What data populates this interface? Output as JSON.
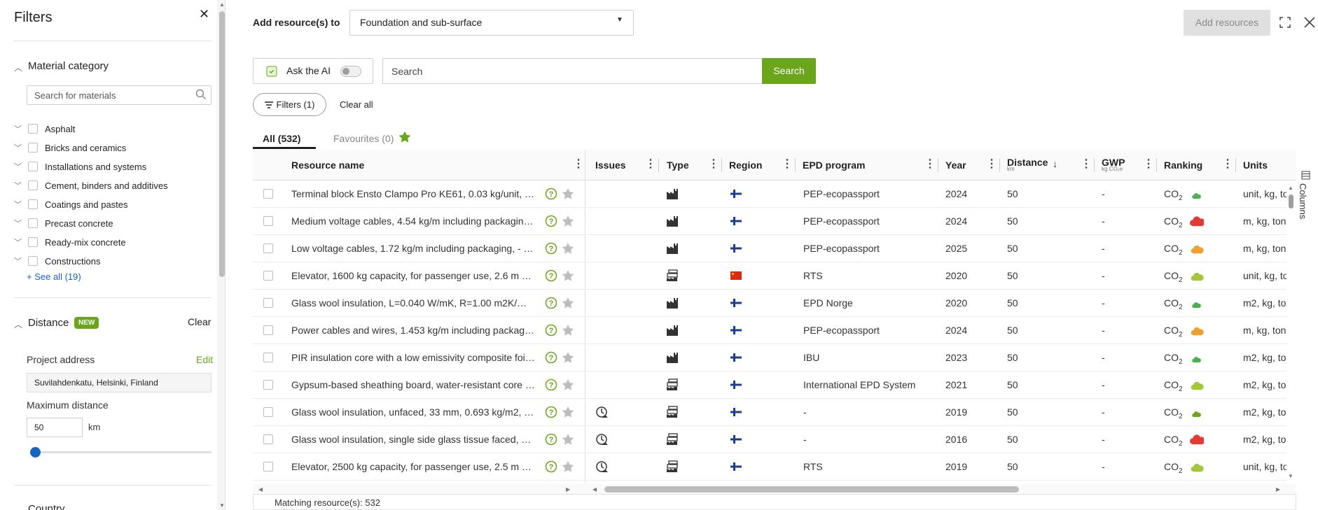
{
  "filters_panel": {
    "title": "Filters",
    "material_category": {
      "title": "Material category",
      "search_placeholder": "Search for materials",
      "items": [
        "Asphalt",
        "Bricks and ceramics",
        "Installations and systems",
        "Cement, binders and additives",
        "Coatings and pastes",
        "Precast concrete",
        "Ready-mix concrete",
        "Constructions"
      ],
      "see_all": "+ See all (19)"
    },
    "distance": {
      "title": "Distance",
      "badge": "NEW",
      "clear": "Clear",
      "project_address_label": "Project address",
      "edit": "Edit",
      "project_address": "Suvilahdenkatu, Helsinki, Finland",
      "max_distance_label": "Maximum distance",
      "max_distance": "50",
      "unit": "km",
      "slider_fraction": 0.0
    },
    "country_title": "Country"
  },
  "top": {
    "add_to_label": "Add resource(s) to",
    "project_selected": "Foundation and sub-surface",
    "add_resources": "Add resources"
  },
  "search": {
    "ai_label": "Ask the AI",
    "placeholder": "Search",
    "button": "Search",
    "filters_button": "Filters (1)",
    "clear_all": "Clear all"
  },
  "tabs": {
    "all": "All (532)",
    "favourites": "Favourites (0)"
  },
  "table": {
    "headers": {
      "resource_name": "Resource name",
      "issues": "Issues",
      "type": "Type",
      "region": "Region",
      "epd_program": "EPD program",
      "year": "Year",
      "distance": "Distance",
      "distance_unit": "km",
      "gwp": "GWP",
      "gwp_unit": "kg CO₂e",
      "ranking": "Ranking",
      "units": "Units"
    },
    "co2_label": "CO",
    "co2_sub": "2",
    "rows": [
      {
        "name": "Terminal block Ensto Clampo Pro KE61, 0.03 kg/unit, …",
        "issue": false,
        "type": "factory",
        "flag": "fi",
        "epd": "PEP-ecopassport",
        "year": "2024",
        "distance": "50",
        "gwp": "-",
        "cloud": "#4caf50",
        "cloud_size": "small",
        "units": "unit, kg, to"
      },
      {
        "name": "Medium voltage cables, 4.54 kg/m including packagin…",
        "issue": false,
        "type": "factory",
        "flag": "fi",
        "epd": "PEP-ecopassport",
        "year": "2024",
        "distance": "50",
        "gwp": "-",
        "cloud": "#e53935",
        "cloud_size": "large",
        "units": "m, kg, ton"
      },
      {
        "name": "Low voltage cables, 1.72 kg/m including packaging, - …",
        "issue": false,
        "type": "factory",
        "flag": "fi",
        "epd": "PEP-ecopassport",
        "year": "2025",
        "distance": "50",
        "gwp": "-",
        "cloud": "#f0a030",
        "cloud_size": "medium",
        "units": "m, kg, ton"
      },
      {
        "name": "Elevator, 1600 kg capacity, for passenger use, 2.6 m …",
        "issue": false,
        "type": "generic",
        "flag": "cn",
        "epd": "RTS",
        "year": "2020",
        "distance": "50",
        "gwp": "-",
        "cloud": "#a4c639",
        "cloud_size": "medium",
        "units": "unit, kg, to"
      },
      {
        "name": "Glass wool insulation, L=0.040 W/mK, R=1.00 m2K/…",
        "issue": false,
        "type": "factory",
        "flag": "fi",
        "epd": "EPD Norge",
        "year": "2020",
        "distance": "50",
        "gwp": "-",
        "cloud": "#4caf50",
        "cloud_size": "small",
        "units": "m2, kg, to"
      },
      {
        "name": "Power cables and wires, 1.453 kg/m including packag…",
        "issue": false,
        "type": "factory",
        "flag": "fi",
        "epd": "PEP-ecopassport",
        "year": "2024",
        "distance": "50",
        "gwp": "-",
        "cloud": "#f0a030",
        "cloud_size": "medium",
        "units": "m, kg, ton"
      },
      {
        "name": "PIR insulation core with a low emissivity composite foi…",
        "issue": false,
        "type": "factory",
        "flag": "fi",
        "epd": "IBU",
        "year": "2023",
        "distance": "50",
        "gwp": "-",
        "cloud": "#4caf50",
        "cloud_size": "small",
        "units": "m2, kg, to"
      },
      {
        "name": "Gypsum-based sheathing board, water-resistant core …",
        "issue": false,
        "type": "generic",
        "flag": "fi",
        "epd": "International EPD System",
        "year": "2021",
        "distance": "50",
        "gwp": "-",
        "cloud": "#a4c639",
        "cloud_size": "medium",
        "units": "m2, kg, to"
      },
      {
        "name": "Glass wool insulation, unfaced, 33 mm, 0.693 kg/m2, …",
        "issue": true,
        "type": "generic",
        "flag": "fi",
        "epd": "-",
        "year": "2019",
        "distance": "50",
        "gwp": "-",
        "cloud": "#6aa51b",
        "cloud_size": "small",
        "units": "m2, kg, to"
      },
      {
        "name": "Glass wool insulation, single side glass tissue faced, …",
        "issue": true,
        "type": "generic",
        "flag": "fi",
        "epd": "-",
        "year": "2016",
        "distance": "50",
        "gwp": "-",
        "cloud": "#e53935",
        "cloud_size": "large",
        "units": "m2, kg, to"
      },
      {
        "name": "Elevator, 2500 kg capacity, for passenger use, 2.5 m …",
        "issue": true,
        "type": "generic",
        "flag": "fi",
        "epd": "RTS",
        "year": "2019",
        "distance": "50",
        "gwp": "-",
        "cloud": "#a4c639",
        "cloud_size": "medium",
        "units": "unit, kg, to"
      }
    ],
    "footer": "Matching resource(s): 532",
    "columns_side": "Columns"
  },
  "colors": {
    "accent_green": "#6aa51b",
    "link_blue": "#1565c0"
  }
}
